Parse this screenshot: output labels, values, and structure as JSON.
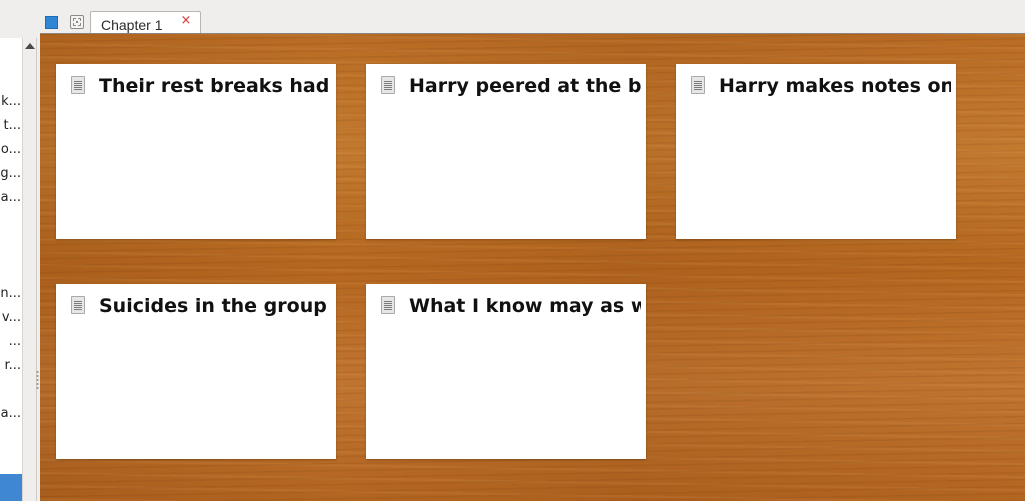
{
  "binder": {
    "items": [
      {
        "text": "k..."
      },
      {
        "text": "t..."
      },
      {
        "text": "o..."
      },
      {
        "text": "g..."
      },
      {
        "text": "a..."
      },
      {
        "text": "n..."
      },
      {
        "text": "v..."
      },
      {
        "text": "..."
      },
      {
        "text": "r..."
      },
      {
        "text": "a..."
      }
    ]
  },
  "tabbar": {
    "tab_label": "Chapter 1",
    "close_glyph": "×"
  },
  "corkboard": {
    "cards": [
      {
        "title": "Their rest breaks had ...",
        "icon": "document-icon"
      },
      {
        "title": "Harry peered at the b...",
        "icon": "document-icon"
      },
      {
        "title": "Harry makes notes on...",
        "icon": "document-icon"
      },
      {
        "title": "Suicides in the group",
        "icon": "document-icon"
      },
      {
        "title": "What I know may as w...",
        "icon": "document-icon"
      }
    ]
  },
  "colors": {
    "accent_blue": "#2f87d3",
    "close_red": "#e0302e",
    "cork_wood": "#b86a22",
    "card_bg": "#ffffff"
  }
}
